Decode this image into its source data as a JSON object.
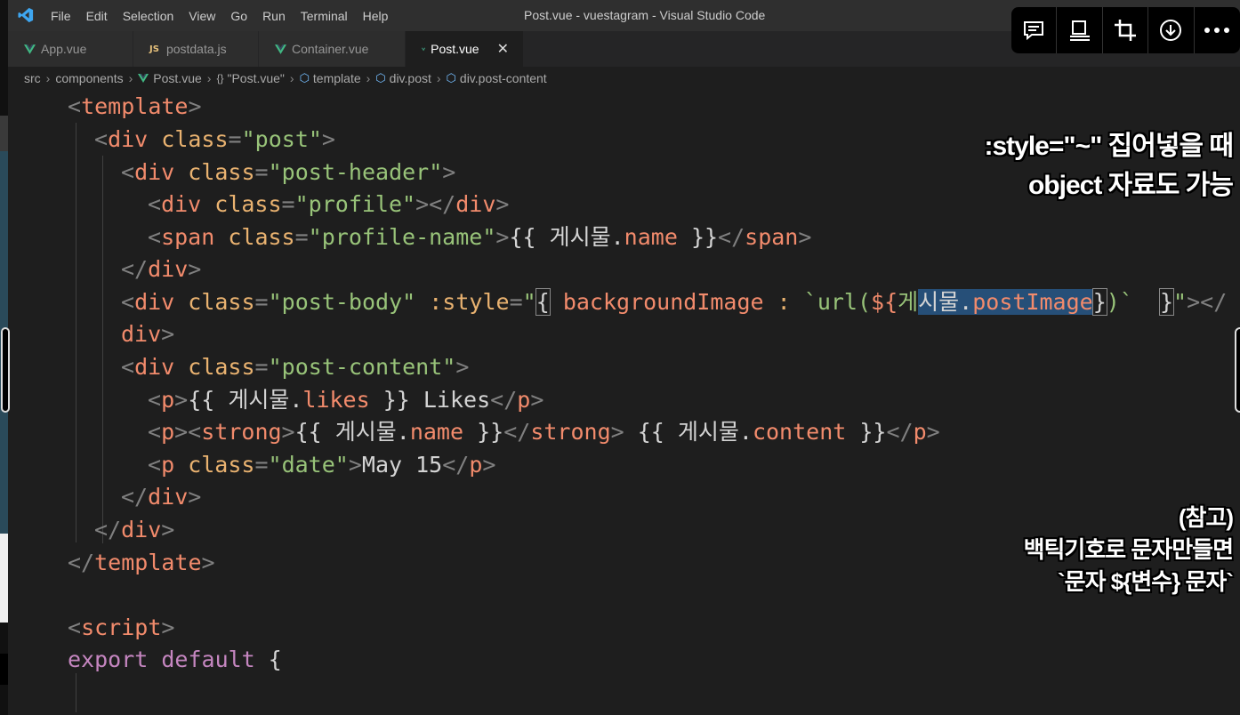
{
  "titlebar": {
    "menu": [
      "File",
      "Edit",
      "Selection",
      "View",
      "Go",
      "Run",
      "Terminal",
      "Help"
    ],
    "title": "Post.vue - vuestagram - Visual Studio Code"
  },
  "tabs": [
    {
      "label": "App.vue",
      "icon": "vue-icon",
      "active": false
    },
    {
      "label": "postdata.js",
      "icon": "js-icon",
      "active": false
    },
    {
      "label": "Container.vue",
      "icon": "vue-icon",
      "active": false
    },
    {
      "label": "Post.vue",
      "icon": "vue-icon",
      "active": true
    }
  ],
  "tab_js_glyph": "JS",
  "tab_close_glyph": "✕",
  "breadcrumb": {
    "items": [
      "src",
      "components",
      "Post.vue",
      "\"Post.vue\"",
      "template",
      "div.post",
      "div.post-content"
    ],
    "braces_glyph": "{}"
  },
  "code": {
    "lines": [
      [
        [
          "p",
          "<"
        ],
        [
          "tag",
          "template"
        ],
        [
          "p",
          ">"
        ]
      ],
      [
        [
          "p",
          "<"
        ],
        [
          "tag",
          "div"
        ],
        [
          "t",
          " "
        ],
        [
          "attr",
          "class"
        ],
        [
          "p",
          "="
        ],
        [
          "str",
          "\"post\""
        ],
        [
          "p",
          ">"
        ]
      ],
      [
        [
          "p",
          "<"
        ],
        [
          "tag",
          "div"
        ],
        [
          "t",
          " "
        ],
        [
          "attr",
          "class"
        ],
        [
          "p",
          "="
        ],
        [
          "str",
          "\"post-header\""
        ],
        [
          "p",
          ">"
        ]
      ],
      [
        [
          "p",
          "<"
        ],
        [
          "tag",
          "div"
        ],
        [
          "t",
          " "
        ],
        [
          "attr",
          "class"
        ],
        [
          "p",
          "="
        ],
        [
          "str",
          "\"profile\""
        ],
        [
          "p",
          "></"
        ],
        [
          "tag",
          "div"
        ],
        [
          "p",
          ">"
        ]
      ],
      [
        [
          "p",
          "<"
        ],
        [
          "tag",
          "span"
        ],
        [
          "t",
          " "
        ],
        [
          "attr",
          "class"
        ],
        [
          "p",
          "="
        ],
        [
          "str",
          "\"profile-name\""
        ],
        [
          "p",
          ">"
        ],
        [
          "t",
          "{{ 게시물."
        ],
        [
          "var",
          "name"
        ],
        [
          "t",
          " }}"
        ],
        [
          "p",
          "</"
        ],
        [
          "tag",
          "span"
        ],
        [
          "p",
          ">"
        ]
      ],
      [
        [
          "p",
          "</"
        ],
        [
          "tag",
          "div"
        ],
        [
          "p",
          ">"
        ]
      ],
      [
        [
          "p",
          "<"
        ],
        [
          "tag",
          "div"
        ],
        [
          "t",
          " "
        ],
        [
          "attr",
          "class"
        ],
        [
          "p",
          "="
        ],
        [
          "str",
          "\"post-body\""
        ],
        [
          "t",
          " "
        ],
        [
          "attr",
          ":style"
        ],
        [
          "p",
          "="
        ],
        [
          "str",
          "\""
        ],
        [
          "box",
          "{"
        ],
        [
          "t",
          " "
        ],
        [
          "var",
          "backgroundImage"
        ],
        [
          "t",
          " "
        ],
        [
          "attr",
          ":"
        ],
        [
          "t",
          " "
        ],
        [
          "str",
          "`url("
        ],
        [
          "var",
          "${"
        ],
        [
          "str",
          "게"
        ],
        [
          "sel",
          "시물."
        ],
        [
          "selvar",
          "postImage"
        ],
        [
          "box",
          "}"
        ],
        [
          "str",
          ")`"
        ],
        [
          "t",
          "  "
        ],
        [
          "box",
          "}"
        ],
        [
          "str",
          "\""
        ],
        [
          "p",
          "></"
        ]
      ],
      [
        [
          "tag",
          "div"
        ],
        [
          "p",
          ">"
        ]
      ],
      [
        [
          "p",
          "<"
        ],
        [
          "tag",
          "div"
        ],
        [
          "t",
          " "
        ],
        [
          "attr",
          "class"
        ],
        [
          "p",
          "="
        ],
        [
          "str",
          "\"post-content\""
        ],
        [
          "p",
          ">"
        ]
      ],
      [
        [
          "p",
          "<"
        ],
        [
          "tag",
          "p"
        ],
        [
          "p",
          ">"
        ],
        [
          "t",
          "{{ 게시물."
        ],
        [
          "var",
          "likes"
        ],
        [
          "t",
          " }} Likes"
        ],
        [
          "p",
          "</"
        ],
        [
          "tag",
          "p"
        ],
        [
          "p",
          ">"
        ]
      ],
      [
        [
          "p",
          "<"
        ],
        [
          "tag",
          "p"
        ],
        [
          "p",
          "><"
        ],
        [
          "tag",
          "strong"
        ],
        [
          "p",
          ">"
        ],
        [
          "t",
          "{{ 게시물."
        ],
        [
          "var",
          "name"
        ],
        [
          "t",
          " }}"
        ],
        [
          "p",
          "</"
        ],
        [
          "tag",
          "strong"
        ],
        [
          "p",
          ">"
        ],
        [
          "t",
          " {{ 게시물."
        ],
        [
          "var",
          "content"
        ],
        [
          "t",
          " }}"
        ],
        [
          "p",
          "</"
        ],
        [
          "tag",
          "p"
        ],
        [
          "p",
          ">"
        ]
      ],
      [
        [
          "p",
          "<"
        ],
        [
          "tag",
          "p"
        ],
        [
          "t",
          " "
        ],
        [
          "attr",
          "class"
        ],
        [
          "p",
          "="
        ],
        [
          "str",
          "\"date\""
        ],
        [
          "p",
          ">"
        ],
        [
          "t",
          "May 15"
        ],
        [
          "p",
          "</"
        ],
        [
          "tag",
          "p"
        ],
        [
          "p",
          ">"
        ]
      ],
      [
        [
          "p",
          "</"
        ],
        [
          "tag",
          "div"
        ],
        [
          "p",
          ">"
        ]
      ],
      [
        [
          "p",
          "</"
        ],
        [
          "tag",
          "div"
        ],
        [
          "p",
          ">"
        ]
      ],
      [
        [
          "p",
          "</"
        ],
        [
          "tag",
          "template"
        ],
        [
          "p",
          ">"
        ]
      ],
      [],
      [
        [
          "p",
          "<"
        ],
        [
          "tag",
          "script"
        ],
        [
          "p",
          ">"
        ]
      ],
      [
        [
          "kw",
          "export"
        ],
        [
          "t",
          " "
        ],
        [
          "kw",
          "default"
        ],
        [
          "t",
          " {"
        ]
      ]
    ]
  },
  "overlay_notes": {
    "note1": [
      ":style=\"~\" 집어넣을 때",
      "object 자료도 가능"
    ],
    "note2": [
      "(참고)",
      "백틱기호로 문자만들면",
      "`문자 ${변수} 문자`"
    ]
  }
}
